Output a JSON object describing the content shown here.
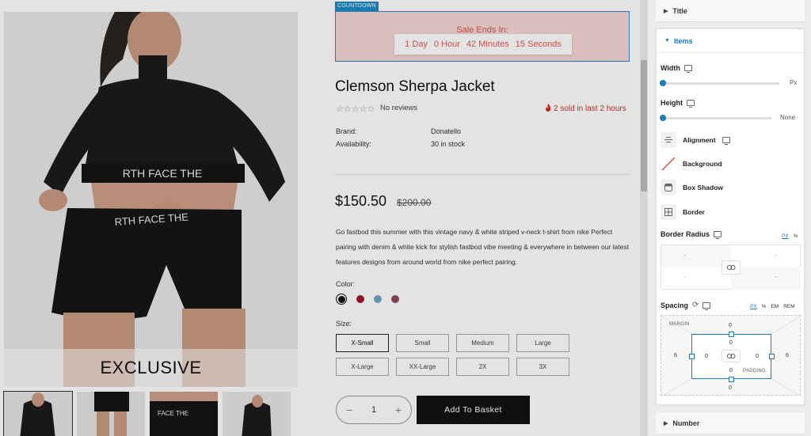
{
  "countdown": {
    "tag": "COUNTDOWN",
    "title": "Sale Ends In:",
    "days": "1 Day",
    "hours": "0 Hour",
    "minutes": "42 Minutes",
    "seconds": "15 Seconds"
  },
  "product": {
    "image_caption": "EXCLUSIVE",
    "title": "Clemson Sherpa Jacket",
    "stars": "☆☆☆☆☆",
    "reviews": "No reviews",
    "sold": "2 sold in last 2 hours",
    "brand_label": "Brand:",
    "brand": "Donatello",
    "availability_label": "Availability:",
    "availability": "30 in stock",
    "price": "$150.50",
    "old_price": "$200.00",
    "description": "Go fastbod this summer with this vintage navy & white striped v-neck t-shirt from nike Perfect pairing with denim & white kick for stylish fastbod vibe meeting & everywhere in between our latest features designs from around world from nike perfect pairing.",
    "color_label": "Color:",
    "colors": [
      "#111111",
      "#a0152a",
      "#6fa6c8",
      "#8c4a5a"
    ],
    "size_label": "Size:",
    "sizes": [
      "X-Small",
      "Small",
      "Medium",
      "Large",
      "X-Large",
      "XX-Large",
      "2X",
      "3X"
    ],
    "quantity": "1",
    "qty_minus": "−",
    "qty_plus": "+",
    "add_to_basket": "Add To Basket"
  },
  "panel": {
    "title_section": "Title",
    "items_section": "Items",
    "width_label": "Width",
    "width_unit": "Px",
    "width_value": 0,
    "height_label": "Height",
    "height_unit": "None",
    "height_value": 0,
    "alignment": "Alignment",
    "background": "Background",
    "box_shadow": "Box Shadow",
    "border": "Border",
    "border_radius": "Border Radius",
    "br_units": [
      "PX",
      "%"
    ],
    "br_values": [
      "-",
      "-",
      "-",
      "-"
    ],
    "spacing": "Spacing",
    "sp_units": [
      "PX",
      "%",
      "EM",
      "REM"
    ],
    "margin_label": "MARGIN",
    "padding_label": "PADDING",
    "margin": {
      "top": "0",
      "right": "6",
      "bottom": "0",
      "left": "6"
    },
    "padding": {
      "top": "0",
      "right": "0",
      "bottom": "0",
      "left": "0"
    },
    "number_section": "Number"
  },
  "colors": {
    "accent": "#1d7ab8",
    "sale_red": "#e05a54",
    "dark_button": "#111111"
  }
}
